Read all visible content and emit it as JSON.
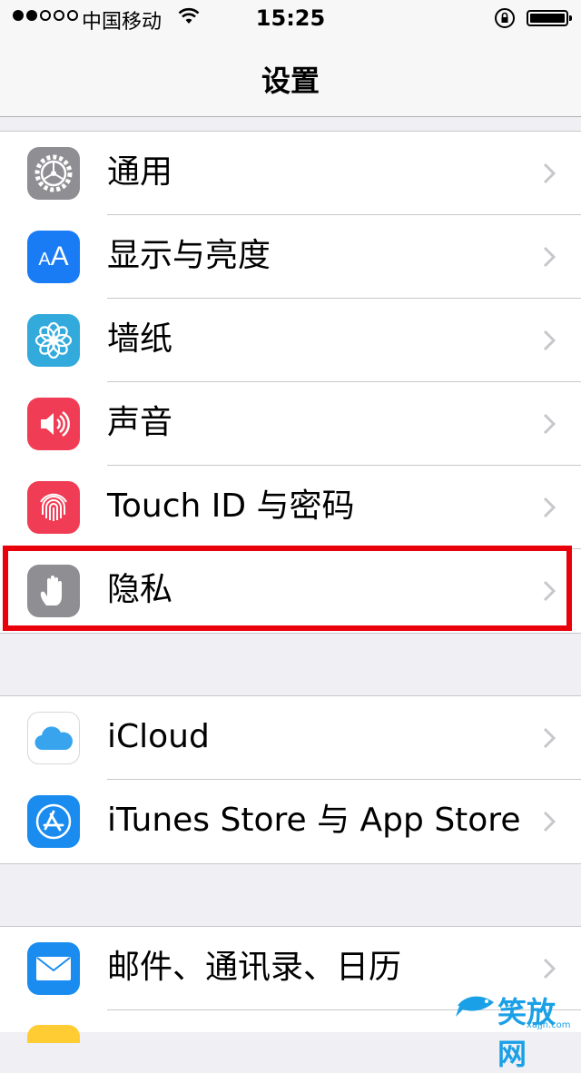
{
  "status_bar": {
    "carrier": "中国移动",
    "time": "15:25",
    "signal_bars_filled": 2,
    "signal_bars_total": 5
  },
  "nav": {
    "title": "设置"
  },
  "groups": [
    {
      "items": [
        {
          "label": "通用",
          "icon": "gear-icon",
          "icon_color": "#8e8e93"
        },
        {
          "label": "显示与亮度",
          "icon": "text-size-icon",
          "icon_color": "#1a7cf5"
        },
        {
          "label": "墙纸",
          "icon": "flower-icon",
          "icon_color": "#33aadc"
        },
        {
          "label": "声音",
          "icon": "speaker-icon",
          "icon_color": "#f03c54"
        },
        {
          "label": "Touch ID 与密码",
          "icon": "fingerprint-icon",
          "icon_color": "#f03c54"
        },
        {
          "label": "隐私",
          "icon": "hand-icon",
          "icon_color": "#8e8e93"
        }
      ]
    },
    {
      "items": [
        {
          "label": "iCloud",
          "icon": "cloud-icon",
          "icon_color": "#ffffff"
        },
        {
          "label": "iTunes Store 与 App Store",
          "icon": "app-store-icon",
          "icon_color": "#1a8cf0"
        }
      ]
    },
    {
      "items": [
        {
          "label": "邮件、通讯录、日历",
          "icon": "mail-icon",
          "icon_color": "#1a8cf0"
        }
      ]
    }
  ],
  "highlight": {
    "color": "#e8000b",
    "target": "隐私"
  },
  "watermark": {
    "text": "笑放网",
    "url": "xajjn.com"
  }
}
